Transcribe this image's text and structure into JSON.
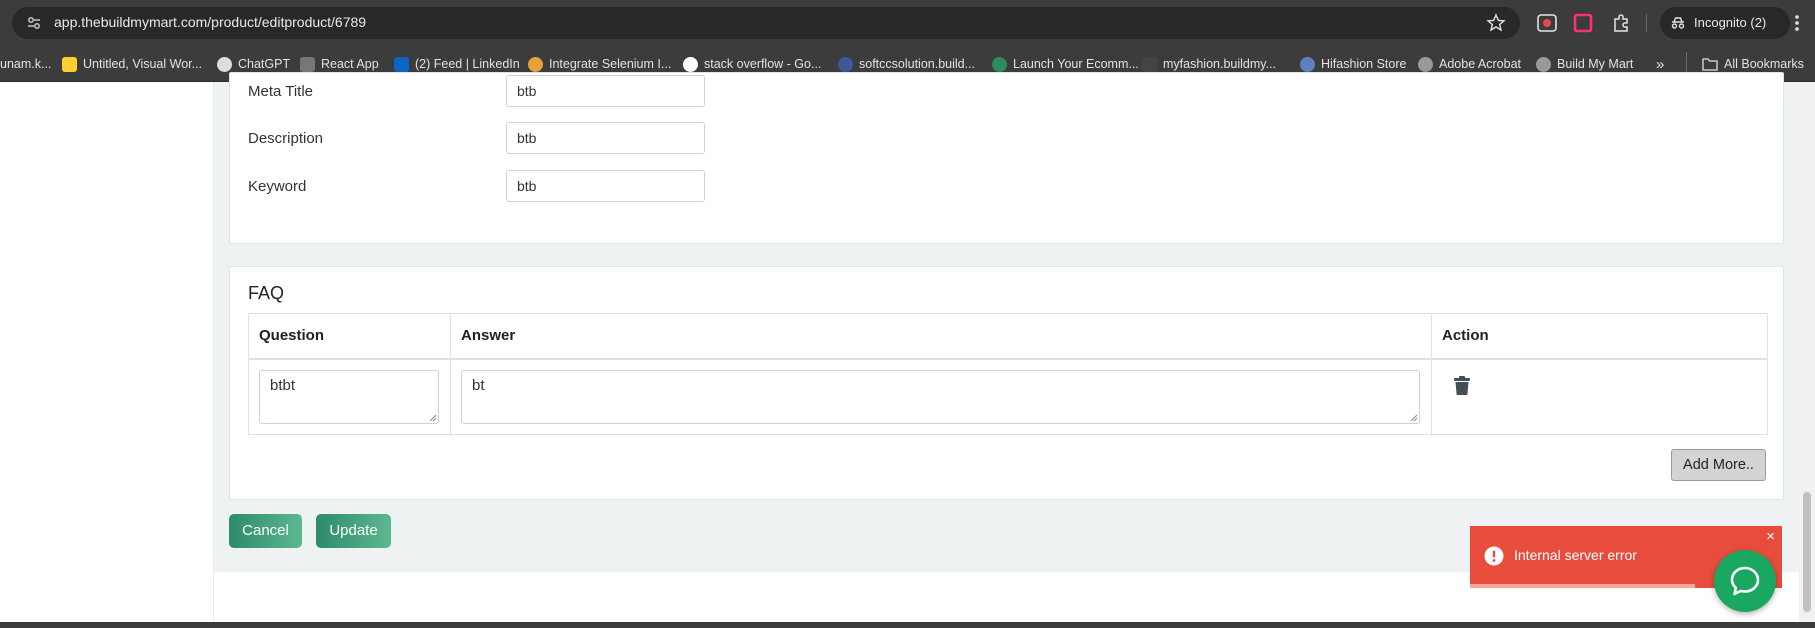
{
  "browser": {
    "url": "app.thebuildmymart.com/product/editproduct/6789",
    "profile_label": "Incognito (2)"
  },
  "bookmarks": {
    "items": [
      {
        "label": "unam.k...",
        "icon": "globe-icon",
        "color": "#888888"
      },
      {
        "label": "Untitled, Visual Wor...",
        "icon": "miro-icon",
        "color": "#ffd02f"
      },
      {
        "label": "ChatGPT",
        "icon": "chatgpt-icon",
        "color": "#cccccc"
      },
      {
        "label": "React App",
        "icon": "react-app-icon",
        "color": "#777777"
      },
      {
        "label": "(2) Feed | LinkedIn",
        "icon": "linkedin-icon",
        "color": "#0a66c2"
      },
      {
        "label": "Integrate Selenium I...",
        "icon": "chrome-icon",
        "color": "#e8a13a"
      },
      {
        "label": "stack overflow - Go...",
        "icon": "google-icon",
        "color": "#ffffff"
      },
      {
        "label": "softccsolution.build...",
        "icon": "site-icon",
        "color": "#3b5998"
      },
      {
        "label": "Launch Your Ecomm...",
        "icon": "store-icon",
        "color": "#2c8c5a"
      },
      {
        "label": "myfashion.buildmy...",
        "icon": "fashion-icon",
        "color": "#444444"
      },
      {
        "label": "Hifashion Store",
        "icon": "hifashion-icon",
        "color": "#5f7fbf"
      },
      {
        "label": "Adobe Acrobat",
        "icon": "globe-icon",
        "color": "#999999"
      },
      {
        "label": "Build My Mart",
        "icon": "globe-icon",
        "color": "#999999"
      }
    ],
    "overflow_label": "»",
    "all_bookmarks_label": "All Bookmarks"
  },
  "meta": {
    "meta_title_label": "Meta Title",
    "meta_title_value": "btb",
    "description_label": "Description",
    "description_value": "btb",
    "keyword_label": "Keyword",
    "keyword_value": "btb"
  },
  "faq": {
    "title": "FAQ",
    "columns": [
      "Question",
      "Answer",
      "Action"
    ],
    "rows": [
      {
        "question": "btbt",
        "answer": "bt"
      }
    ],
    "add_more_label": "Add More.."
  },
  "actions": {
    "cancel_label": "Cancel",
    "update_label": "Update"
  },
  "toast": {
    "message": "Internal server error",
    "close_label": "×",
    "progress_fraction": 0.72,
    "color": "#e74c3c"
  },
  "colors": {
    "primary_green": "#2e8b6a",
    "chat_green": "#1aa760"
  }
}
